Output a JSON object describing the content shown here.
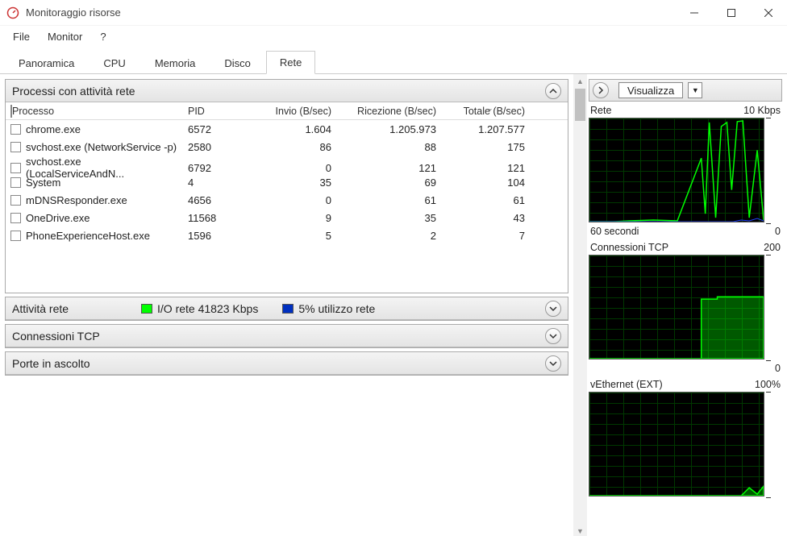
{
  "window": {
    "title": "Monitoraggio risorse"
  },
  "menu": {
    "file": "File",
    "monitor": "Monitor",
    "help": "?"
  },
  "tabs": {
    "panoramica": "Panoramica",
    "cpu": "CPU",
    "memoria": "Memoria",
    "disco": "Disco",
    "rete": "Rete"
  },
  "panels": {
    "processes": {
      "title": "Processi con attività rete",
      "columns": {
        "proc": "Processo",
        "pid": "PID",
        "send": "Invio (B/sec)",
        "recv": "Ricezione (B/sec)",
        "total": "Totale (B/sec)"
      },
      "rows": [
        {
          "name": "chrome.exe",
          "pid": "6572",
          "send": "1.604",
          "recv": "1.205.973",
          "total": "1.207.577"
        },
        {
          "name": "svchost.exe (NetworkService -p)",
          "pid": "2580",
          "send": "86",
          "recv": "88",
          "total": "175"
        },
        {
          "name": "svchost.exe (LocalServiceAndN...",
          "pid": "6792",
          "send": "0",
          "recv": "121",
          "total": "121"
        },
        {
          "name": "System",
          "pid": "4",
          "send": "35",
          "recv": "69",
          "total": "104"
        },
        {
          "name": "mDNSResponder.exe",
          "pid": "4656",
          "send": "0",
          "recv": "61",
          "total": "61"
        },
        {
          "name": "OneDrive.exe",
          "pid": "11568",
          "send": "9",
          "recv": "35",
          "total": "43"
        },
        {
          "name": "PhoneExperienceHost.exe",
          "pid": "1596",
          "send": "5",
          "recv": "2",
          "total": "7"
        }
      ]
    },
    "activity": {
      "title": "Attività rete",
      "io_label": "I/O rete 41823 Kbps",
      "util_label": "5% utilizzo rete"
    },
    "tcp": {
      "title": "Connessioni TCP"
    },
    "ports": {
      "title": "Porte in ascolto"
    }
  },
  "right": {
    "visualizza": "Visualizza",
    "charts": [
      {
        "title": "Rete",
        "scale": "10 Kbps",
        "foot_left": "60 secondi",
        "foot_right": "0"
      },
      {
        "title": "Connessioni TCP",
        "scale": "200",
        "foot_left": "",
        "foot_right": "0"
      },
      {
        "title": "vEthernet (EXT)",
        "scale": "100%",
        "foot_left": "",
        "foot_right": ""
      }
    ]
  },
  "colors": {
    "io_swatch": "#00ff00",
    "util_swatch": "#0030c0"
  }
}
